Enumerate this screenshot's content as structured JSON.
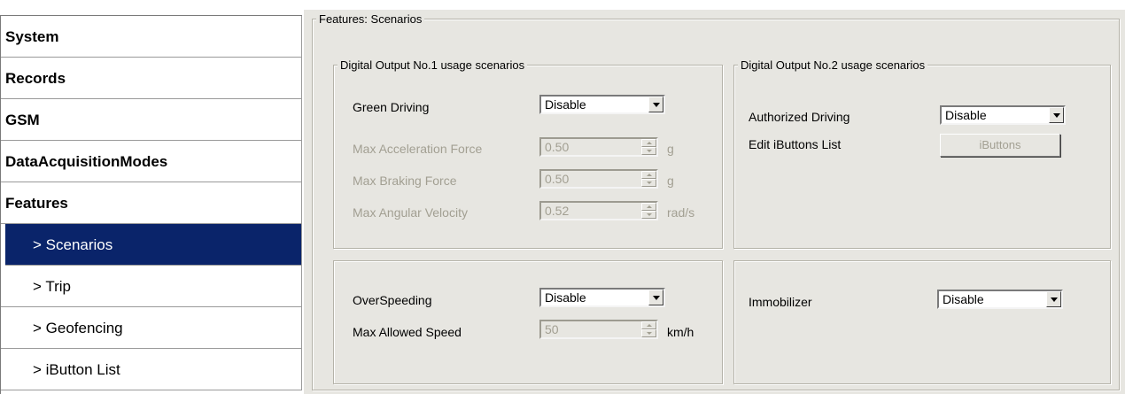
{
  "sidebar": {
    "items": [
      {
        "label": "System"
      },
      {
        "label": "Records"
      },
      {
        "label": "GSM"
      },
      {
        "label": "DataAcquisitionModes"
      },
      {
        "label": "Features"
      },
      {
        "label": "> Scenarios"
      },
      {
        "label": "> Trip"
      },
      {
        "label": "> Geofencing"
      },
      {
        "label": "> iButton List"
      }
    ],
    "selected": "> Scenarios"
  },
  "main": {
    "title": "Features: Scenarios",
    "do1": {
      "title": "Digital Output No.1 usage scenarios",
      "green_driving": {
        "label": "Green Driving",
        "value": "Disable"
      },
      "max_accel": {
        "label": "Max Acceleration Force",
        "value": "0.50",
        "unit": "g"
      },
      "max_braking": {
        "label": "Max Braking Force",
        "value": "0.50",
        "unit": "g"
      },
      "max_angular": {
        "label": "Max Angular Velocity",
        "value": "0.52",
        "unit": "rad/s"
      }
    },
    "do2": {
      "title": "Digital Output No.2 usage scenarios",
      "authorized_driving": {
        "label": "Authorized Driving",
        "value": "Disable"
      },
      "ibuttons": {
        "label": "Edit iButtons List",
        "button": "iButtons"
      }
    },
    "overspeed": {
      "label": "OverSpeeding",
      "value": "Disable",
      "max_speed": {
        "label": "Max Allowed Speed",
        "value": "50",
        "unit": "km/h"
      }
    },
    "immobilizer": {
      "label": "Immobilizer",
      "value": "Disable"
    }
  },
  "colors": {
    "selected_bg": "#0a246a",
    "panel_bg": "#e7e6e1",
    "disabled_text": "#a29f92"
  }
}
